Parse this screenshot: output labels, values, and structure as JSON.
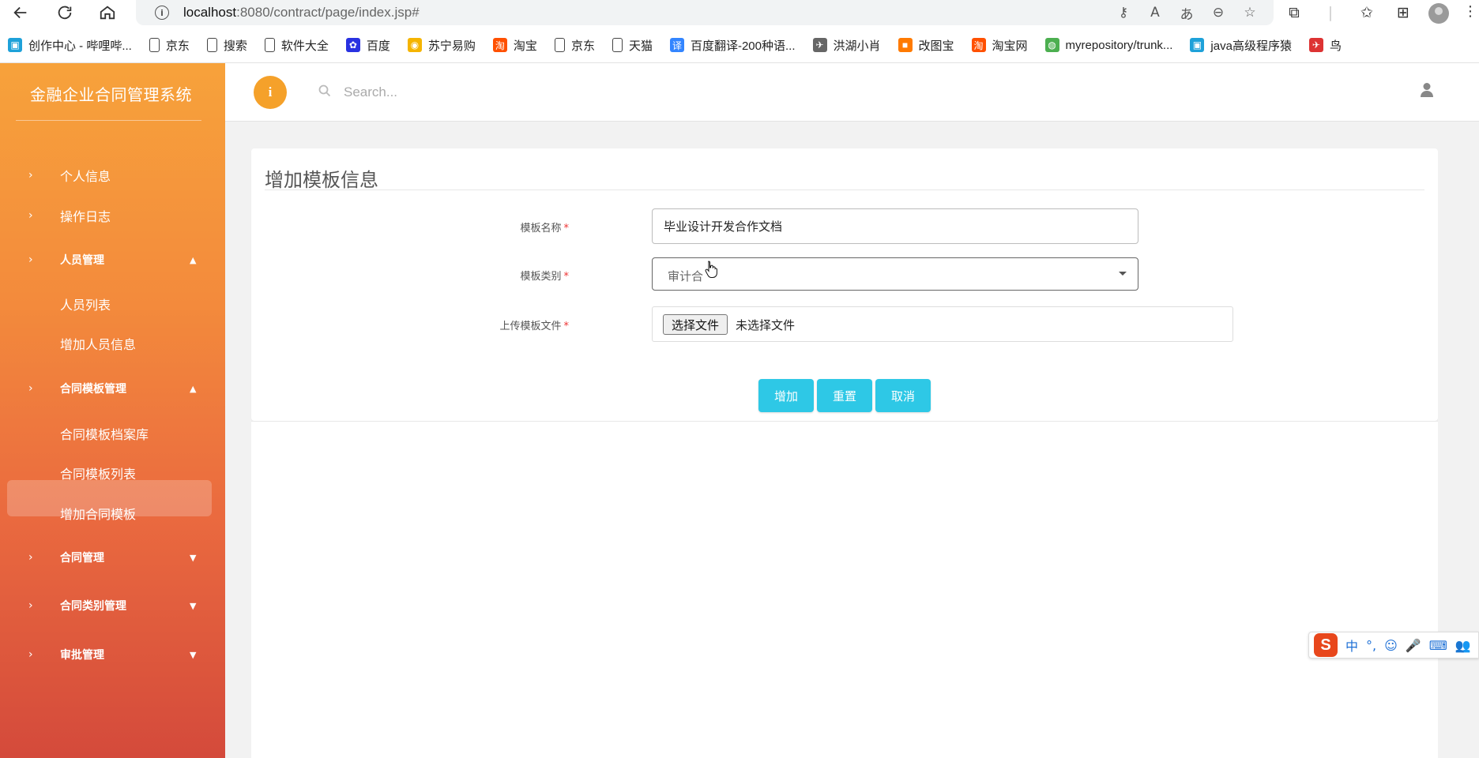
{
  "browser": {
    "url_host": "localhost",
    "url_path": ":8080/contract/page/index.jsp#",
    "bookmarks": [
      {
        "label": "创作中心 - 哔哩哔...",
        "icon": "bilibili-icon",
        "color": "#1ea1d9"
      },
      {
        "label": "京东",
        "icon": "page-icon",
        "color": ""
      },
      {
        "label": "搜索",
        "icon": "page-icon",
        "color": ""
      },
      {
        "label": "软件大全",
        "icon": "page-icon",
        "color": ""
      },
      {
        "label": "百度",
        "icon": "baidu-icon",
        "color": "#2932e1"
      },
      {
        "label": "苏宁易购",
        "icon": "suning-icon",
        "color": "#f5b400"
      },
      {
        "label": "淘宝",
        "icon": "taobao-icon",
        "color": "#ff5000"
      },
      {
        "label": "京东",
        "icon": "page-icon",
        "color": ""
      },
      {
        "label": "天猫",
        "icon": "page-icon",
        "color": ""
      },
      {
        "label": "百度翻译-200种语...",
        "icon": "translate-icon",
        "color": "#3385ff"
      },
      {
        "label": "洪湖小肖",
        "icon": "bird-icon",
        "color": "#666"
      },
      {
        "label": "改图宝",
        "icon": "gaitubao-icon",
        "color": "#ff7a00"
      },
      {
        "label": "淘宝网",
        "icon": "taobao-icon",
        "color": "#ff5000"
      },
      {
        "label": "myrepository/trunk...",
        "icon": "chrome-icon",
        "color": "#4caf50"
      },
      {
        "label": "java高级程序猿",
        "icon": "bilibili-icon",
        "color": "#1ea1d9"
      },
      {
        "label": "鸟",
        "icon": "bird-icon",
        "color": "#d33"
      }
    ]
  },
  "sidebar": {
    "title": "金融企业合同管理系统",
    "items": [
      {
        "label": "个人信息"
      },
      {
        "label": "操作日志"
      },
      {
        "label": "人员管理"
      },
      {
        "label": "人员列表"
      },
      {
        "label": "增加人员信息"
      },
      {
        "label": "合同模板管理"
      },
      {
        "label": "合同模板档案库"
      },
      {
        "label": "合同模板列表"
      },
      {
        "label": "增加合同模板"
      },
      {
        "label": "合同管理"
      },
      {
        "label": "合同类别管理"
      },
      {
        "label": "审批管理"
      }
    ]
  },
  "header": {
    "search_placeholder": "Search...",
    "info_glyph": "i"
  },
  "form": {
    "title": "增加模板信息",
    "name_label": "模板名称",
    "name_value": "毕业设计开发合作文档",
    "category_label": "模板类别",
    "category_value": "审计合",
    "file_label": "上传模板文件",
    "file_button": "选择文件",
    "file_status": "未选择文件",
    "required_mark": "*",
    "buttons": {
      "add": "增加",
      "reset": "重置",
      "cancel": "取消"
    }
  },
  "ime": {
    "logo": "S",
    "mode": "中",
    "punct": "°,"
  },
  "colors": {
    "accent": "#2ec8e6",
    "sidebar_top": "#f7a23b",
    "sidebar_bottom": "#d44a3b",
    "info": "#f5a12a"
  }
}
